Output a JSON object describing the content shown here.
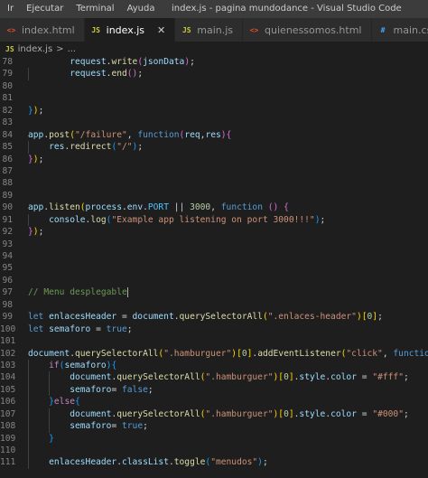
{
  "menu": [
    "Ir",
    "Ejecutar",
    "Terminal",
    "Ayuda"
  ],
  "window_title": "index.js - pagina mundodance - Visual Studio Code",
  "tabs": [
    {
      "label": "index.html",
      "icon": "html-file-icon",
      "active": false
    },
    {
      "label": "index.js",
      "icon": "js-file-icon",
      "active": true
    },
    {
      "label": "main.js",
      "icon": "js-file-icon",
      "active": false
    },
    {
      "label": "quienessomos.html",
      "icon": "html-file-icon",
      "active": false
    },
    {
      "label": "main.css",
      "icon": "css-file-icon",
      "active": false
    }
  ],
  "close_glyph": "✕",
  "breadcrumb": {
    "file": "index.js",
    "separator": ">",
    "rest": "..."
  },
  "line_numbers": [
    "78",
    "79",
    "80",
    "81",
    "82",
    "83",
    "84",
    "85",
    "86",
    "87",
    "88",
    "89",
    "90",
    "91",
    "92",
    "93",
    "94",
    "95",
    "96",
    "97",
    "98",
    "99",
    "100",
    "101",
    "102",
    "103",
    "104",
    "105",
    "106",
    "107",
    "108",
    "109",
    "110",
    "111"
  ],
  "code_lines": [
    [
      {
        "t": "        request.write(jsonData);",
        "segs": [
          [
            "        ",
            "pl"
          ],
          [
            "request",
            "var"
          ],
          [
            ".",
            "pl"
          ],
          [
            "write",
            "fn"
          ],
          [
            "(",
            "br2"
          ],
          [
            "jsonData",
            "var"
          ],
          [
            ")",
            "br2"
          ],
          [
            ";",
            "pl"
          ]
        ]
      }
    ],
    [
      {
        "segs": [
          [
            "        ",
            "pl"
          ],
          [
            "request",
            "var"
          ],
          [
            ".",
            "pl"
          ],
          [
            "end",
            "fn"
          ],
          [
            "()",
            "br2"
          ],
          [
            ";",
            "pl"
          ]
        ]
      }
    ],
    [
      {
        "segs": []
      }
    ],
    [
      {
        "segs": []
      }
    ],
    [
      {
        "segs": [
          [
            "}",
            "br3"
          ],
          [
            ")",
            "br1"
          ],
          [
            ";",
            "pl"
          ]
        ]
      }
    ],
    [
      {
        "segs": []
      }
    ],
    [
      {
        "segs": [
          [
            "app",
            "var"
          ],
          [
            ".",
            "pl"
          ],
          [
            "post",
            "fn"
          ],
          [
            "(",
            "br1"
          ],
          [
            "\"/failure\"",
            "str"
          ],
          [
            ", ",
            "pl"
          ],
          [
            "function",
            "kw"
          ],
          [
            "(",
            "br2"
          ],
          [
            "req",
            "var"
          ],
          [
            ",",
            "pl"
          ],
          [
            "res",
            "var"
          ],
          [
            ")",
            "br2"
          ],
          [
            "{",
            "br2"
          ]
        ]
      }
    ],
    [
      {
        "segs": [
          [
            "    ",
            "pl"
          ],
          [
            "res",
            "var"
          ],
          [
            ".",
            "pl"
          ],
          [
            "redirect",
            "fn"
          ],
          [
            "(",
            "br3"
          ],
          [
            "\"/\"",
            "str"
          ],
          [
            ")",
            "br3"
          ],
          [
            ";",
            "pl"
          ]
        ]
      }
    ],
    [
      {
        "segs": [
          [
            "}",
            "br2"
          ],
          [
            ")",
            "br1"
          ],
          [
            ";",
            "pl"
          ]
        ]
      }
    ],
    [
      {
        "segs": []
      }
    ],
    [
      {
        "segs": []
      }
    ],
    [
      {
        "segs": []
      }
    ],
    [
      {
        "segs": [
          [
            "app",
            "var"
          ],
          [
            ".",
            "pl"
          ],
          [
            "listen",
            "fn"
          ],
          [
            "(",
            "br1"
          ],
          [
            "process",
            "var"
          ],
          [
            ".",
            "pl"
          ],
          [
            "env",
            "var"
          ],
          [
            ".",
            "pl"
          ],
          [
            "PORT",
            "const"
          ],
          [
            " || ",
            "pl"
          ],
          [
            "3000",
            "num"
          ],
          [
            ", ",
            "pl"
          ],
          [
            "function",
            "kw"
          ],
          [
            " ",
            "pl"
          ],
          [
            "()",
            "br2"
          ],
          [
            " ",
            "pl"
          ],
          [
            "{",
            "br2"
          ]
        ]
      }
    ],
    [
      {
        "segs": [
          [
            "    ",
            "pl"
          ],
          [
            "console",
            "var"
          ],
          [
            ".",
            "pl"
          ],
          [
            "log",
            "fn"
          ],
          [
            "(",
            "br3"
          ],
          [
            "\"Example app listening on port 3000!!!\"",
            "str"
          ],
          [
            ")",
            "br3"
          ],
          [
            ";",
            "pl"
          ]
        ]
      }
    ],
    [
      {
        "segs": [
          [
            "}",
            "br2"
          ],
          [
            ")",
            "br1"
          ],
          [
            ";",
            "pl"
          ]
        ]
      }
    ],
    [
      {
        "segs": []
      }
    ],
    [
      {
        "segs": []
      }
    ],
    [
      {
        "segs": []
      }
    ],
    [
      {
        "segs": []
      }
    ],
    [
      {
        "segs": [
          [
            "// Menu desplegable",
            "com"
          ]
        ],
        "cursor": true
      }
    ],
    [
      {
        "segs": []
      }
    ],
    [
      {
        "segs": [
          [
            "let",
            "kw"
          ],
          [
            " ",
            "pl"
          ],
          [
            "enlacesHeader",
            "var"
          ],
          [
            " = ",
            "pl"
          ],
          [
            "document",
            "var"
          ],
          [
            ".",
            "pl"
          ],
          [
            "querySelectorAll",
            "fn"
          ],
          [
            "(",
            "br1"
          ],
          [
            "\".enlaces-header\"",
            "str"
          ],
          [
            ")",
            "br1"
          ],
          [
            "[",
            "br1"
          ],
          [
            "0",
            "num"
          ],
          [
            "]",
            "br1"
          ],
          [
            ";",
            "pl"
          ]
        ]
      }
    ],
    [
      {
        "segs": [
          [
            "let",
            "kw"
          ],
          [
            " ",
            "pl"
          ],
          [
            "semaforo",
            "var"
          ],
          [
            " = ",
            "pl"
          ],
          [
            "true",
            "kw"
          ],
          [
            ";",
            "pl"
          ]
        ]
      }
    ],
    [
      {
        "segs": []
      }
    ],
    [
      {
        "segs": [
          [
            "document",
            "var"
          ],
          [
            ".",
            "pl"
          ],
          [
            "querySelectorAll",
            "fn"
          ],
          [
            "(",
            "br1"
          ],
          [
            "\".hamburguer\"",
            "str"
          ],
          [
            ")",
            "br1"
          ],
          [
            "[",
            "br1"
          ],
          [
            "0",
            "num"
          ],
          [
            "]",
            "br1"
          ],
          [
            ".",
            "pl"
          ],
          [
            "addEventListener",
            "fn"
          ],
          [
            "(",
            "br1"
          ],
          [
            "\"click\"",
            "str"
          ],
          [
            ", ",
            "pl"
          ],
          [
            "function",
            "kw"
          ],
          [
            "(",
            "br2"
          ]
        ]
      }
    ],
    [
      {
        "segs": [
          [
            "    ",
            "pl"
          ],
          [
            "if",
            "ctl"
          ],
          [
            "(",
            "br3"
          ],
          [
            "semaforo",
            "var"
          ],
          [
            ")",
            "br3"
          ],
          [
            "{",
            "br3"
          ]
        ]
      }
    ],
    [
      {
        "segs": [
          [
            "        ",
            "pl"
          ],
          [
            "document",
            "var"
          ],
          [
            ".",
            "pl"
          ],
          [
            "querySelectorAll",
            "fn"
          ],
          [
            "(",
            "br1"
          ],
          [
            "\".hamburguer\"",
            "str"
          ],
          [
            ")",
            "br1"
          ],
          [
            "[",
            "br1"
          ],
          [
            "0",
            "num"
          ],
          [
            "]",
            "br1"
          ],
          [
            ".",
            "pl"
          ],
          [
            "style",
            "var"
          ],
          [
            ".",
            "pl"
          ],
          [
            "color",
            "var"
          ],
          [
            " = ",
            "pl"
          ],
          [
            "\"#fff\"",
            "str"
          ],
          [
            ";",
            "pl"
          ]
        ]
      }
    ],
    [
      {
        "segs": [
          [
            "        ",
            "pl"
          ],
          [
            "semaforo",
            "var"
          ],
          [
            "= ",
            "pl"
          ],
          [
            "false",
            "kw"
          ],
          [
            ";",
            "pl"
          ]
        ]
      }
    ],
    [
      {
        "segs": [
          [
            "    ",
            "pl"
          ],
          [
            "}",
            "br3"
          ],
          [
            "else",
            "ctl"
          ],
          [
            "{",
            "br3"
          ]
        ]
      }
    ],
    [
      {
        "segs": [
          [
            "        ",
            "pl"
          ],
          [
            "document",
            "var"
          ],
          [
            ".",
            "pl"
          ],
          [
            "querySelectorAll",
            "fn"
          ],
          [
            "(",
            "br1"
          ],
          [
            "\".hamburguer\"",
            "str"
          ],
          [
            ")",
            "br1"
          ],
          [
            "[",
            "br1"
          ],
          [
            "0",
            "num"
          ],
          [
            "]",
            "br1"
          ],
          [
            ".",
            "pl"
          ],
          [
            "style",
            "var"
          ],
          [
            ".",
            "pl"
          ],
          [
            "color",
            "var"
          ],
          [
            " = ",
            "pl"
          ],
          [
            "\"#000\"",
            "str"
          ],
          [
            ";",
            "pl"
          ]
        ]
      }
    ],
    [
      {
        "segs": [
          [
            "        ",
            "pl"
          ],
          [
            "semaforo",
            "var"
          ],
          [
            "= ",
            "pl"
          ],
          [
            "true",
            "kw"
          ],
          [
            ";",
            "pl"
          ]
        ]
      }
    ],
    [
      {
        "segs": [
          [
            "    ",
            "pl"
          ],
          [
            "}",
            "br3"
          ]
        ]
      }
    ],
    [
      {
        "segs": []
      }
    ],
    [
      {
        "segs": [
          [
            "    ",
            "pl"
          ],
          [
            "enlacesHeader",
            "var"
          ],
          [
            ".",
            "pl"
          ],
          [
            "classList",
            "var"
          ],
          [
            ".",
            "pl"
          ],
          [
            "toggle",
            "fn"
          ],
          [
            "(",
            "br3"
          ],
          [
            "\"menudos\"",
            "str"
          ],
          [
            ")",
            "br3"
          ],
          [
            ";",
            "pl"
          ]
        ]
      }
    ]
  ]
}
